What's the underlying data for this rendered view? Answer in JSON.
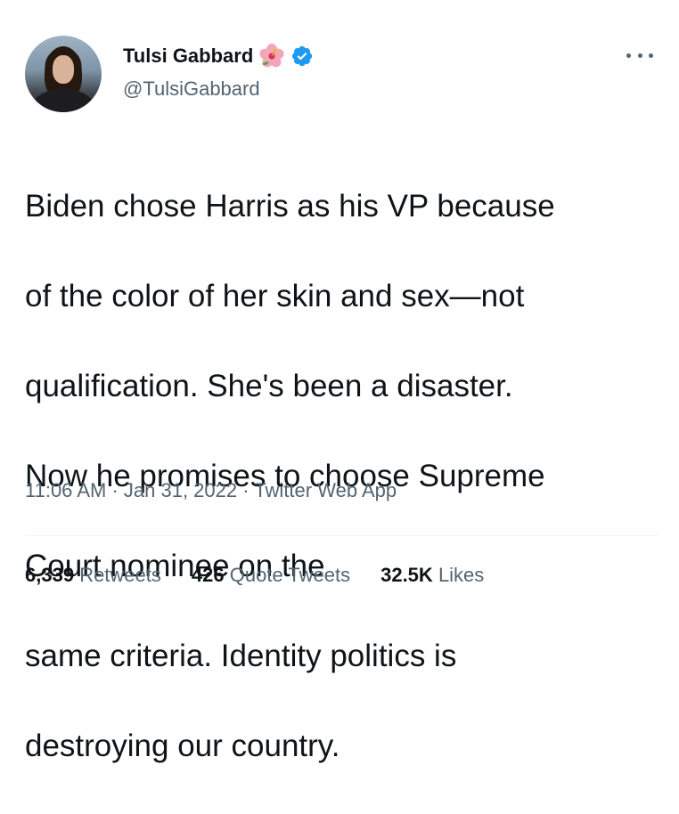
{
  "author": {
    "display_name": "Tulsi Gabbard",
    "handle": "@TulsiGabbard",
    "verified": true,
    "name_emoji": "hibiscus-icon"
  },
  "tweet": {
    "text_lines": [
      "Biden chose Harris as his VP because",
      "of the color of her skin and sex—not",
      "qualification. She's been a disaster.",
      "Now he promises to choose Supreme",
      "Court nominee on the",
      "same criteria. Identity politics is",
      "destroying our country."
    ],
    "time": "11:06 AM",
    "date": "Jan 31, 2022",
    "source": "Twitter Web App"
  },
  "stats": {
    "retweets_count": "6,339",
    "retweets_label": "Retweets",
    "quotes_count": "426",
    "quotes_label": "Quote Tweets",
    "likes_count": "32.5K",
    "likes_label": "Likes"
  },
  "colors": {
    "text_primary": "#0f1419",
    "text_secondary": "#536471",
    "verified_blue": "#1d9bf0",
    "divider": "#eff3f4"
  }
}
